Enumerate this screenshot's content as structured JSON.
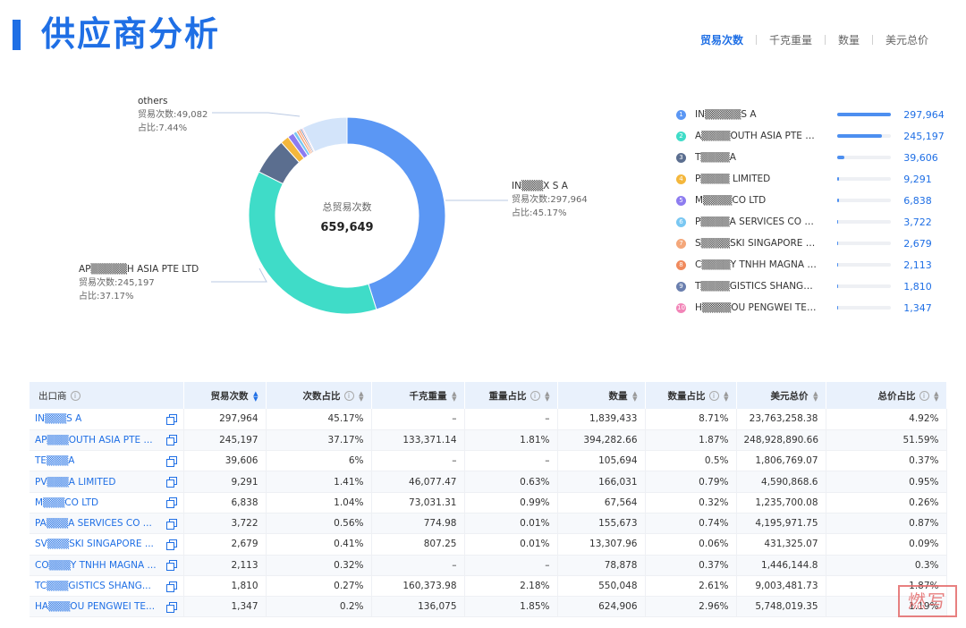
{
  "header": {
    "title": "供应商分析",
    "tabs": [
      {
        "label": "贸易次数",
        "active": true
      },
      {
        "label": "千克重量",
        "active": false
      },
      {
        "label": "数量",
        "active": false
      },
      {
        "label": "美元总价",
        "active": false
      }
    ]
  },
  "donut": {
    "center_label": "总贸易次数",
    "center_value": "659,649",
    "callouts": [
      {
        "name": "others",
        "value_line": "贸易次数:49,082",
        "pct_line": "占比:7.44%"
      },
      {
        "name": "IN▒▒▒X S A",
        "value_line": "贸易次数:297,964",
        "pct_line": "占比:45.17%"
      },
      {
        "name": "AP▒▒▒▒▒H ASIA PTE LTD",
        "value_line": "贸易次数:245,197",
        "pct_line": "占比:37.17%"
      }
    ]
  },
  "chart_data": {
    "type": "pie",
    "categories": [
      "IN▒▒▒X S A",
      "AP▒▒▒▒UTH ASIA PTE LTD",
      "T▒▒▒A",
      "P▒▒▒ LIMITED",
      "M▒▒▒CO LTD",
      "P▒▒▒A SERVICES CO LTD",
      "S▒▒▒SKI SINGAPORE T...",
      "C▒▒▒ TNHH MAGNA M...",
      "T▒▒▒GISTICS SHANGH...",
      "H▒▒▒OU PENGWEI TEC...",
      "others"
    ],
    "values": [
      297964,
      245197,
      39606,
      9291,
      6838,
      3722,
      2679,
      2113,
      1810,
      1347,
      49082
    ],
    "colors": [
      "#5b97f4",
      "#3fdcc8",
      "#5b6e8f",
      "#f4b73c",
      "#8d7cf0",
      "#79c7f2",
      "#f4a77a",
      "#f08a5d",
      "#6a7fae",
      "#f285b8",
      "#d3e4fa"
    ]
  },
  "ranking": [
    {
      "rank": "1",
      "name": "IN▒▒▒▒▒S A",
      "value": "297,964",
      "fraction": 1.0,
      "color": "#5b97f4"
    },
    {
      "rank": "2",
      "name": "A▒▒▒▒OUTH ASIA PTE LTD",
      "value": "245,197",
      "fraction": 0.823,
      "color": "#3fdcc8"
    },
    {
      "rank": "3",
      "name": "T▒▒▒▒A",
      "value": "39,606",
      "fraction": 0.133,
      "color": "#5b6e8f"
    },
    {
      "rank": "4",
      "name": "P▒▒▒▒ LIMITED",
      "value": "9,291",
      "fraction": 0.031,
      "color": "#f4b73c"
    },
    {
      "rank": "5",
      "name": "M▒▒▒▒CO LTD",
      "value": "6,838",
      "fraction": 0.023,
      "color": "#8d7cf0"
    },
    {
      "rank": "6",
      "name": "P▒▒▒▒A SERVICES CO LTD",
      "value": "3,722",
      "fraction": 0.012,
      "color": "#79c7f2"
    },
    {
      "rank": "7",
      "name": "S▒▒▒▒SKI SINGAPORE T...",
      "value": "2,679",
      "fraction": 0.009,
      "color": "#f4a77a"
    },
    {
      "rank": "8",
      "name": "C▒▒▒▒Y TNHH MAGNA M...",
      "value": "2,113",
      "fraction": 0.007,
      "color": "#f08a5d"
    },
    {
      "rank": "9",
      "name": "T▒▒▒▒GISTICS SHANGH...",
      "value": "1,810",
      "fraction": 0.006,
      "color": "#6a7fae"
    },
    {
      "rank": "10",
      "name": "H▒▒▒▒OU PENGWEI TEC...",
      "value": "1,347",
      "fraction": 0.0045,
      "color": "#f285b8"
    }
  ],
  "table": {
    "columns": [
      {
        "label": "出口商",
        "info": true,
        "sort": false
      },
      {
        "label": "贸易次数",
        "info": false,
        "sort": true,
        "sort_active": true
      },
      {
        "label": "次数占比",
        "info": true,
        "sort": true
      },
      {
        "label": "千克重量",
        "info": false,
        "sort": true
      },
      {
        "label": "重量占比",
        "info": true,
        "sort": true
      },
      {
        "label": "数量",
        "info": false,
        "sort": true
      },
      {
        "label": "数量占比",
        "info": true,
        "sort": true
      },
      {
        "label": "美元总价",
        "info": false,
        "sort": true
      },
      {
        "label": "总价占比",
        "info": true,
        "sort": true
      }
    ],
    "rows": [
      [
        "IN▒▒▒S A",
        "297,964",
        "45.17%",
        "–",
        "–",
        "1,839,433",
        "8.71%",
        "23,763,258.38",
        "4.92%"
      ],
      [
        "AP▒▒▒OUTH ASIA PTE ...",
        "245,197",
        "37.17%",
        "133,371.14",
        "1.81%",
        "394,282.66",
        "1.87%",
        "248,928,890.66",
        "51.59%"
      ],
      [
        "TE▒▒▒A",
        "39,606",
        "6%",
        "–",
        "–",
        "105,694",
        "0.5%",
        "1,806,769.07",
        "0.37%"
      ],
      [
        "PV▒▒▒A LIMITED",
        "9,291",
        "1.41%",
        "46,077.47",
        "0.63%",
        "166,031",
        "0.79%",
        "4,590,868.6",
        "0.95%"
      ],
      [
        "M▒▒▒CO LTD",
        "6,838",
        "1.04%",
        "73,031.31",
        "0.99%",
        "67,564",
        "0.32%",
        "1,235,700.08",
        "0.26%"
      ],
      [
        "PA▒▒▒A SERVICES CO ...",
        "3,722",
        "0.56%",
        "774.98",
        "0.01%",
        "155,673",
        "0.74%",
        "4,195,971.75",
        "0.87%"
      ],
      [
        "SV▒▒▒SKI SINGAPORE ...",
        "2,679",
        "0.41%",
        "807.25",
        "0.01%",
        "13,307.96",
        "0.06%",
        "431,325.07",
        "0.09%"
      ],
      [
        "CO▒▒▒Y TNHH MAGNA ...",
        "2,113",
        "0.32%",
        "–",
        "–",
        "78,878",
        "0.37%",
        "1,446,144.8",
        "0.3%"
      ],
      [
        "TC▒▒▒GISTICS SHANG...",
        "1,810",
        "0.27%",
        "160,373.98",
        "2.18%",
        "550,048",
        "2.61%",
        "9,003,481.73",
        "1.87%"
      ],
      [
        "HA▒▒▒OU PENGWEI TE...",
        "1,347",
        "0.2%",
        "136,075",
        "1.85%",
        "624,906",
        "2.96%",
        "5,748,019.35",
        "1.19%"
      ]
    ]
  },
  "watermark": "燃写"
}
